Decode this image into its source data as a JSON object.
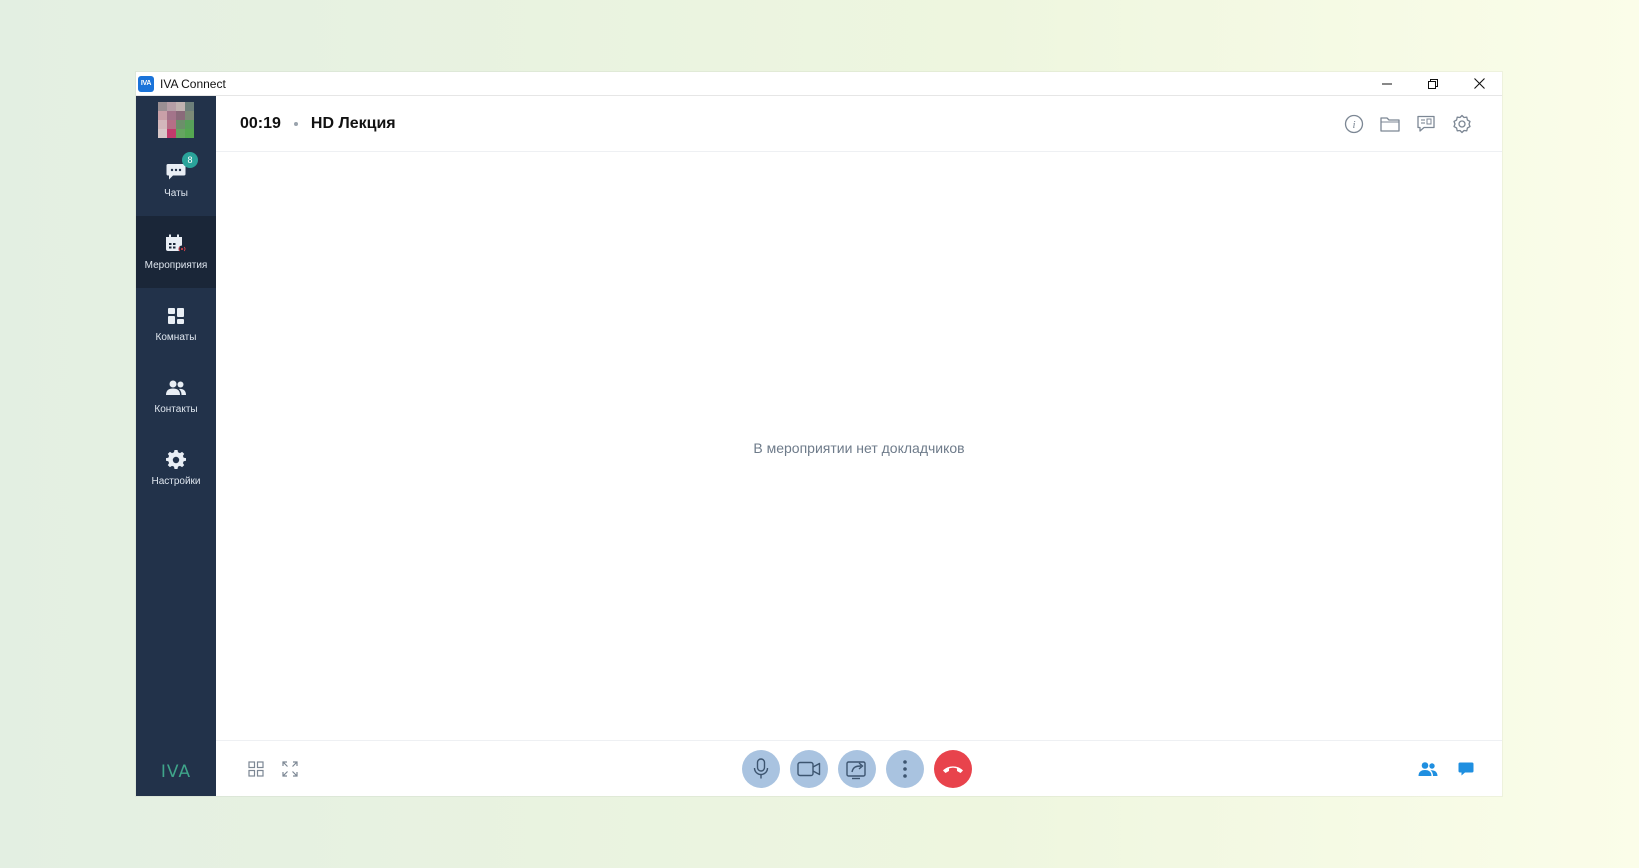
{
  "titlebar": {
    "app_logo": "IVA",
    "app_title": "IVA Connect",
    "controls": [
      "minimize-icon",
      "restore-icon",
      "close-icon"
    ]
  },
  "sidebar": {
    "items": [
      {
        "label": "Чаты",
        "icon": "chat-icon",
        "badge": "8",
        "active": false
      },
      {
        "label": "Мероприятия",
        "icon": "calendar-broadcast-icon",
        "active": true
      },
      {
        "label": "Комнаты",
        "icon": "rooms-icon",
        "active": false
      },
      {
        "label": "Контакты",
        "icon": "contacts-icon",
        "active": false
      },
      {
        "label": "Настройки",
        "icon": "gear-icon",
        "active": false
      }
    ],
    "brand": "IVA"
  },
  "header": {
    "timer": "00:19",
    "event_title": "HD Лекция",
    "actions": [
      "info-icon",
      "folder-icon",
      "notes-icon",
      "settings-icon"
    ]
  },
  "stage": {
    "empty_message": "В мероприятии нет докладчиков"
  },
  "footer": {
    "left": [
      "grid-layout-icon",
      "fullscreen-icon"
    ],
    "controls": [
      "microphone-icon",
      "camera-icon",
      "screen-share-icon",
      "more-icon",
      "hang-up-icon"
    ],
    "right": [
      "participants-icon",
      "chat-icon"
    ]
  },
  "colors": {
    "sidebar": "#22324a",
    "sidebar_active": "#1a2638",
    "control_bg": "#a9c3e0",
    "hang_up": "#e8434c",
    "accent": "#1f8fe0",
    "badge": "#2aa39a"
  }
}
